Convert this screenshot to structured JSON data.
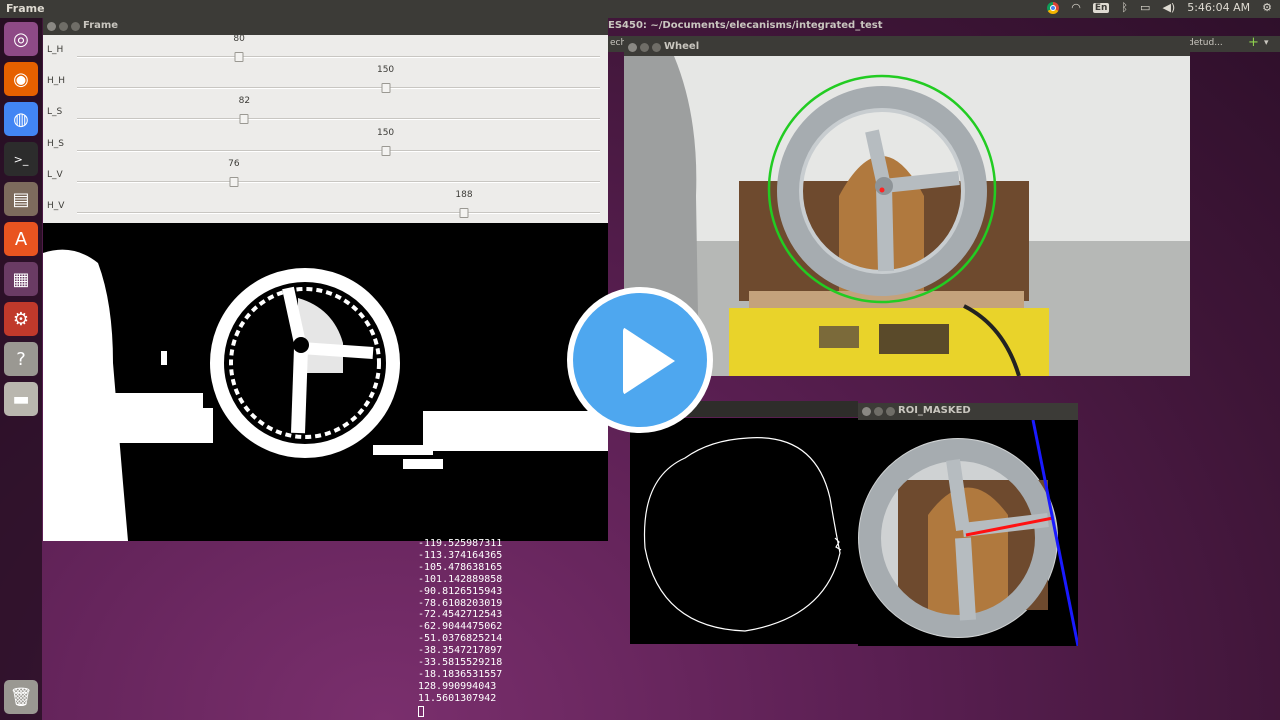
{
  "top_panel": {
    "app_title": "Frame",
    "keyboard_layout": "En",
    "clock": "5:46:04 AM"
  },
  "launcher": {
    "items": [
      {
        "icon": "ubuntu-dash-icon",
        "color": "#8e4a86"
      },
      {
        "icon": "firefox-icon",
        "color": "#e66000"
      },
      {
        "icon": "chrome-icon",
        "color": "#4285f4"
      },
      {
        "icon": "terminal-icon",
        "color": "#2c2c2c"
      },
      {
        "icon": "files-icon",
        "color": "#7d6b5d"
      },
      {
        "icon": "software-center-icon",
        "color": "#e95420"
      },
      {
        "icon": "workspace-icon",
        "color": "#6a3b64"
      },
      {
        "icon": "settings-icon",
        "color": "#c0392b"
      },
      {
        "icon": "help-icon",
        "color": "#9a9892"
      },
      {
        "icon": "drive-icon",
        "color": "#b9b6ae"
      },
      {
        "icon": "trash-icon",
        "color": "#9a9892"
      }
    ]
  },
  "frame_window": {
    "title": "Frame",
    "sliders": [
      {
        "label": "L_H",
        "value": "80",
        "level": 0.31
      },
      {
        "label": "H_H",
        "value": "150",
        "level": 0.59
      },
      {
        "label": "L_S",
        "value": "82",
        "level": 0.32
      },
      {
        "label": "H_S",
        "value": "150",
        "level": 0.59
      },
      {
        "label": "L_V",
        "value": "76",
        "level": 0.3
      },
      {
        "label": "H_V",
        "value": "188",
        "level": 0.74
      }
    ]
  },
  "terminal_window": {
    "title": "ES450: ~/Documents/elecanisms/integrated_test",
    "tab_fragment_left": "ech",
    "tab_fragment_right": "detud...",
    "output_lines": [
      "-119.525987311",
      "-113.374164365",
      "-105.478638165",
      "-101.142889858",
      "-90.8126515943",
      "-78.6108203019",
      "-72.4542712543",
      "-62.9044475062",
      "-51.0376825214",
      "-38.3547217897",
      "-33.5815529218",
      "-18.1836531557",
      "128.990994043",
      "11.5601307942"
    ]
  },
  "wheel_window": {
    "title": "Wheel"
  },
  "roi_masked_window": {
    "title": "ROI_MASKED"
  },
  "colors": {
    "detection_circle": "#22cc22",
    "center_point": "#ff2222",
    "angle_line": "#ff1111",
    "edge_line": "#1a1aff",
    "play_button": "#4ea7ef"
  }
}
